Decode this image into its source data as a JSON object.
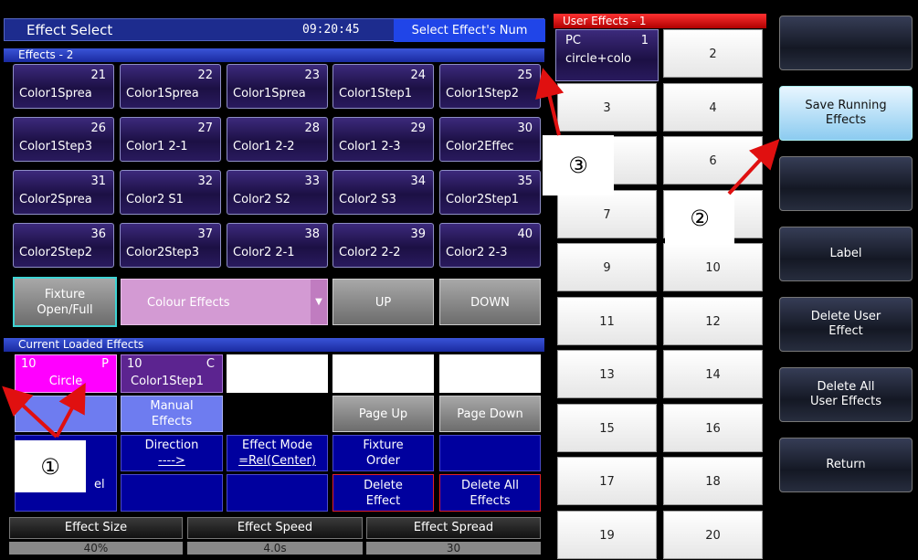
{
  "header": {
    "title": "Effect Select",
    "clock": "09:20:45",
    "hint": "Select Effect's Num"
  },
  "effects": {
    "section_label": "Effects - 2",
    "items": [
      {
        "num": "21",
        "label": "Color1Sprea"
      },
      {
        "num": "22",
        "label": "Color1Sprea"
      },
      {
        "num": "23",
        "label": "Color1Sprea"
      },
      {
        "num": "24",
        "label": "Color1Step1"
      },
      {
        "num": "25",
        "label": "Color1Step2"
      },
      {
        "num": "26",
        "label": "Color1Step3"
      },
      {
        "num": "27",
        "label": "Color1 2-1"
      },
      {
        "num": "28",
        "label": "Color1 2-2"
      },
      {
        "num": "29",
        "label": "Color1 2-3"
      },
      {
        "num": "30",
        "label": "Color2Effec"
      },
      {
        "num": "31",
        "label": "Color2Sprea"
      },
      {
        "num": "32",
        "label": "Color2 S1"
      },
      {
        "num": "33",
        "label": "Color2 S2"
      },
      {
        "num": "34",
        "label": "Color2 S3"
      },
      {
        "num": "35",
        "label": "Color2Step1"
      },
      {
        "num": "36",
        "label": "Color2Step2"
      },
      {
        "num": "37",
        "label": "Color2Step3"
      },
      {
        "num": "38",
        "label": "Color2 2-1"
      },
      {
        "num": "39",
        "label": "Color2 2-2"
      },
      {
        "num": "40",
        "label": "Color2 2-3"
      }
    ],
    "fixture_button": "Fixture\nOpen/Full",
    "category_select": "Colour Effects",
    "up": "UP",
    "down": "DOWN"
  },
  "current": {
    "section_label": "Current Loaded Effects",
    "slot1_num": "10",
    "slot1_flag": "P",
    "slot1_label": "Circle",
    "slot2_num": "10",
    "slot2_flag": "C",
    "slot2_label": "Color1Step1",
    "manual": "Manual\nEffects",
    "page_up": "Page Up",
    "page_down": "Page Down",
    "direction_label": "Direction",
    "direction_value": "---->",
    "mode_label": "Effect Mode",
    "mode_value": "=Rel(Center)",
    "fixture_order": "Fixture\nOrder",
    "delete_effect": "Delete\nEffect",
    "delete_all": "Delete All\nEffects",
    "partial_label": "el"
  },
  "params": [
    {
      "label": "Effect Size",
      "value": "40%"
    },
    {
      "label": "Effect Speed",
      "value": "4.0s"
    },
    {
      "label": "Effect Spread",
      "value": "30"
    }
  ],
  "user_effects": {
    "header": "User Effects - 1",
    "first": {
      "prefix": "PC",
      "num": "1",
      "label": "circle+colo"
    },
    "cells": [
      "2",
      "3",
      "4",
      "",
      "6",
      "7",
      "",
      "9",
      "10",
      "11",
      "12",
      "13",
      "14",
      "15",
      "16",
      "17",
      "18",
      "19",
      "20"
    ]
  },
  "menu": [
    "",
    "Save Running\nEffects",
    "",
    "Label",
    "Delete User\nEffect",
    "Delete All\nUser Effects",
    "Return"
  ],
  "callouts": [
    "①",
    "②",
    "③"
  ],
  "colors": {
    "accent_blue": "#1d2c8e",
    "user_header_red": "#e02020",
    "arrow_red": "#e01010",
    "magenta": "#ff00ff",
    "active_menu": "#bfe6ff"
  }
}
